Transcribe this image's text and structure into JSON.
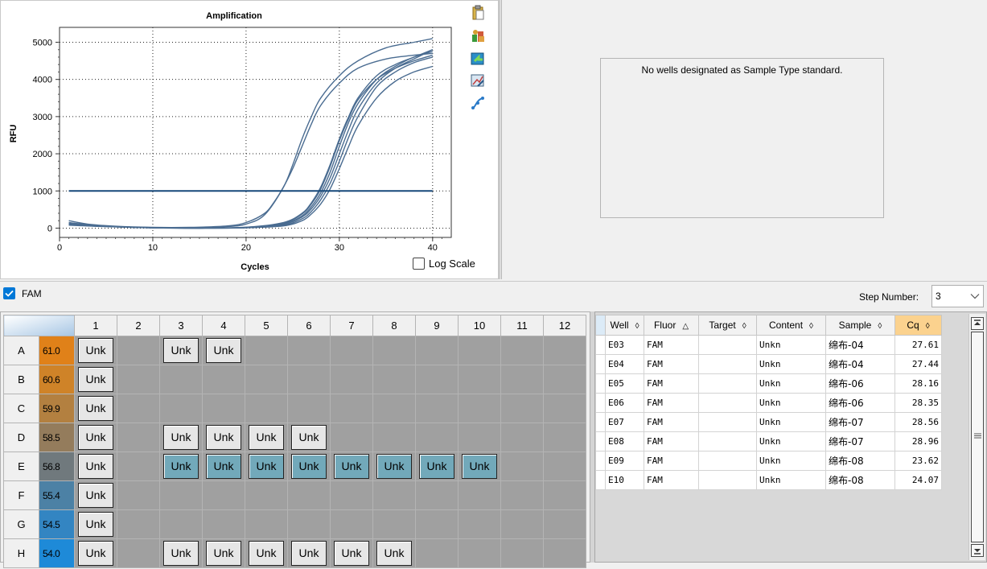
{
  "chart": {
    "chart_data": {
      "type": "line",
      "title": "Amplification",
      "xlabel": "Cycles",
      "ylabel": "RFU",
      "xlim": [
        0,
        42
      ],
      "ylim": [
        -250,
        5400
      ],
      "x_ticks": [
        0,
        10,
        20,
        30,
        40
      ],
      "y_ticks": [
        0,
        1000,
        2000,
        3000,
        4000,
        5000
      ],
      "grid": true,
      "threshold": 1000,
      "threshold_color": "#17497a",
      "series_color": "#4a6c91",
      "series": [
        {
          "values": [
            [
              1,
              150
            ],
            [
              3,
              90
            ],
            [
              6,
              40
            ],
            [
              10,
              15
            ],
            [
              14,
              10
            ],
            [
              18,
              40
            ],
            [
              20,
              110
            ],
            [
              22,
              360
            ],
            [
              24,
              1100
            ],
            [
              25,
              1700
            ],
            [
              26,
              2400
            ],
            [
              27,
              3000
            ],
            [
              28,
              3500
            ],
            [
              30,
              4100
            ],
            [
              32,
              4500
            ],
            [
              35,
              4850
            ],
            [
              38,
              5000
            ],
            [
              40,
              5100
            ]
          ]
        },
        {
          "values": [
            [
              1,
              200
            ],
            [
              3,
              110
            ],
            [
              6,
              50
            ],
            [
              10,
              20
            ],
            [
              14,
              20
            ],
            [
              18,
              60
            ],
            [
              20,
              150
            ],
            [
              22,
              400
            ],
            [
              23,
              700
            ],
            [
              24,
              1100
            ],
            [
              25,
              1600
            ],
            [
              26,
              2200
            ],
            [
              27,
              2800
            ],
            [
              28,
              3300
            ],
            [
              30,
              3900
            ],
            [
              32,
              4300
            ],
            [
              35,
              4550
            ],
            [
              38,
              4650
            ],
            [
              40,
              4700
            ]
          ]
        },
        {
          "values": [
            [
              1,
              110
            ],
            [
              5,
              50
            ],
            [
              10,
              15
            ],
            [
              15,
              5
            ],
            [
              20,
              25
            ],
            [
              24,
              150
            ],
            [
              26,
              400
            ],
            [
              27,
              680
            ],
            [
              28,
              1100
            ],
            [
              29,
              1700
            ],
            [
              30,
              2400
            ],
            [
              31,
              3000
            ],
            [
              32,
              3500
            ],
            [
              34,
              4100
            ],
            [
              36,
              4400
            ],
            [
              38,
              4600
            ],
            [
              40,
              4800
            ]
          ]
        },
        {
          "values": [
            [
              1,
              90
            ],
            [
              5,
              45
            ],
            [
              10,
              12
            ],
            [
              15,
              5
            ],
            [
              20,
              22
            ],
            [
              24,
              130
            ],
            [
              26,
              380
            ],
            [
              27,
              650
            ],
            [
              28,
              1050
            ],
            [
              29,
              1650
            ],
            [
              30,
              2350
            ],
            [
              31,
              2950
            ],
            [
              32,
              3450
            ],
            [
              34,
              4000
            ],
            [
              36,
              4300
            ],
            [
              38,
              4500
            ],
            [
              40,
              4650
            ]
          ]
        },
        {
          "values": [
            [
              1,
              140
            ],
            [
              5,
              55
            ],
            [
              10,
              10
            ],
            [
              15,
              0
            ],
            [
              20,
              18
            ],
            [
              24,
              110
            ],
            [
              26,
              330
            ],
            [
              27,
              580
            ],
            [
              28,
              950
            ],
            [
              29,
              1500
            ],
            [
              30,
              2200
            ],
            [
              31,
              2850
            ],
            [
              32,
              3350
            ],
            [
              34,
              4000
            ],
            [
              36,
              4350
            ],
            [
              38,
              4600
            ],
            [
              40,
              4750
            ]
          ]
        },
        {
          "values": [
            [
              1,
              80
            ],
            [
              5,
              40
            ],
            [
              10,
              10
            ],
            [
              15,
              0
            ],
            [
              20,
              15
            ],
            [
              24,
              100
            ],
            [
              26,
              300
            ],
            [
              27,
              520
            ],
            [
              28,
              860
            ],
            [
              29,
              1350
            ],
            [
              30,
              2000
            ],
            [
              31,
              2650
            ],
            [
              32,
              3200
            ],
            [
              34,
              3900
            ],
            [
              36,
              4300
            ],
            [
              38,
              4550
            ],
            [
              40,
              4800
            ]
          ]
        },
        {
          "values": [
            [
              1,
              120
            ],
            [
              5,
              50
            ],
            [
              10,
              10
            ],
            [
              15,
              0
            ],
            [
              20,
              12
            ],
            [
              24,
              80
            ],
            [
              26,
              250
            ],
            [
              27,
              450
            ],
            [
              28,
              760
            ],
            [
              29,
              1200
            ],
            [
              30,
              1800
            ],
            [
              31,
              2450
            ],
            [
              32,
              3000
            ],
            [
              34,
              3800
            ],
            [
              36,
              4200
            ],
            [
              38,
              4450
            ],
            [
              40,
              4600
            ]
          ]
        },
        {
          "values": [
            [
              1,
              100
            ],
            [
              5,
              45
            ],
            [
              10,
              8
            ],
            [
              15,
              0
            ],
            [
              20,
              10
            ],
            [
              24,
              60
            ],
            [
              26,
              200
            ],
            [
              27,
              380
            ],
            [
              28,
              650
            ],
            [
              29,
              1050
            ],
            [
              30,
              1600
            ],
            [
              31,
              2200
            ],
            [
              32,
              2750
            ],
            [
              34,
              3500
            ],
            [
              36,
              3950
            ],
            [
              38,
              4200
            ],
            [
              40,
              4350
            ]
          ]
        }
      ]
    },
    "log_scale_label": "Log Scale",
    "tool_icons": [
      "clipboard-icon",
      "export-icon",
      "plot-export-icon",
      "chart-settings-icon",
      "curve-fit-icon"
    ]
  },
  "standard": {
    "message": "No wells designated as Sample Type standard."
  },
  "fluor": {
    "name": "FAM",
    "step_label": "Step Number:",
    "step_value": "3"
  },
  "plate": {
    "columns": [
      "1",
      "2",
      "3",
      "4",
      "5",
      "6",
      "7",
      "8",
      "9",
      "10",
      "11",
      "12"
    ],
    "rows": [
      {
        "label": "A",
        "temp": "61.0",
        "color": "#e08119",
        "wells": [
          "Unk",
          "",
          "Unk",
          "Unk",
          "",
          "",
          "",
          "",
          "",
          "",
          "",
          ""
        ]
      },
      {
        "label": "B",
        "temp": "60.6",
        "color": "#cf8328",
        "wells": [
          "Unk",
          "",
          "",
          "",
          "",
          "",
          "",
          "",
          "",
          "",
          "",
          ""
        ]
      },
      {
        "label": "C",
        "temp": "59.9",
        "color": "#b38040",
        "wells": [
          "Unk",
          "",
          "",
          "",
          "",
          "",
          "",
          "",
          "",
          "",
          "",
          ""
        ]
      },
      {
        "label": "D",
        "temp": "58.5",
        "color": "#947c5c",
        "wells": [
          "Unk",
          "",
          "Unk",
          "Unk",
          "Unk",
          "Unk",
          "",
          "",
          "",
          "",
          "",
          ""
        ]
      },
      {
        "label": "E",
        "temp": "56.8",
        "color": "#70797d",
        "wells": [
          "Unk",
          "",
          "Unk*",
          "Unk*",
          "Unk*",
          "Unk*",
          "Unk*",
          "Unk*",
          "Unk*",
          "Unk*",
          "",
          ""
        ]
      },
      {
        "label": "F",
        "temp": "55.4",
        "color": "#4c81a5",
        "wells": [
          "Unk",
          "",
          "",
          "",
          "",
          "",
          "",
          "",
          "",
          "",
          "",
          ""
        ]
      },
      {
        "label": "G",
        "temp": "54.5",
        "color": "#3385c2",
        "wells": [
          "Unk",
          "",
          "",
          "",
          "",
          "",
          "",
          "",
          "",
          "",
          "",
          ""
        ]
      },
      {
        "label": "H",
        "temp": "54.0",
        "color": "#1e8ad8",
        "wells": [
          "Unk",
          "",
          "Unk",
          "Unk",
          "Unk",
          "Unk",
          "Unk",
          "Unk",
          "",
          "",
          "",
          ""
        ]
      }
    ]
  },
  "results": {
    "headers": [
      {
        "label": "Well",
        "sort": "◊"
      },
      {
        "label": "Fluor",
        "sort": "△"
      },
      {
        "label": "Target",
        "sort": "◊"
      },
      {
        "label": "Content",
        "sort": "◊"
      },
      {
        "label": "Sample",
        "sort": "◊"
      },
      {
        "label": "Cq",
        "sort": "◊"
      }
    ],
    "rows": [
      {
        "well": "E03",
        "fluor": "FAM",
        "target": "",
        "content": "Unkn",
        "sample": "绵布-04",
        "cq": "27.61"
      },
      {
        "well": "E04",
        "fluor": "FAM",
        "target": "",
        "content": "Unkn",
        "sample": "绵布-04",
        "cq": "27.44"
      },
      {
        "well": "E05",
        "fluor": "FAM",
        "target": "",
        "content": "Unkn",
        "sample": "绵布-06",
        "cq": "28.16"
      },
      {
        "well": "E06",
        "fluor": "FAM",
        "target": "",
        "content": "Unkn",
        "sample": "绵布-06",
        "cq": "28.35"
      },
      {
        "well": "E07",
        "fluor": "FAM",
        "target": "",
        "content": "Unkn",
        "sample": "绵布-07",
        "cq": "28.56"
      },
      {
        "well": "E08",
        "fluor": "FAM",
        "target": "",
        "content": "Unkn",
        "sample": "绵布-07",
        "cq": "28.96"
      },
      {
        "well": "E09",
        "fluor": "FAM",
        "target": "",
        "content": "Unkn",
        "sample": "绵布-08",
        "cq": "23.62"
      },
      {
        "well": "E10",
        "fluor": "FAM",
        "target": "",
        "content": "Unkn",
        "sample": "绵布-08",
        "cq": "24.07"
      }
    ]
  }
}
